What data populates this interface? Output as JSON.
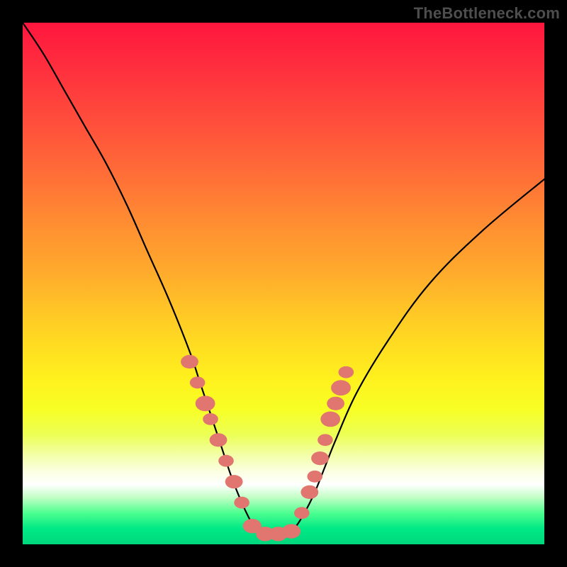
{
  "watermark": "TheBottleneck.com",
  "colors": {
    "gradient_top": "#ff163e",
    "gradient_mid": "#ffd024",
    "gradient_bottom": "#00d77e",
    "curve": "#000000",
    "marker": "#e0766f",
    "frame": "#000000"
  },
  "chart_data": {
    "type": "line",
    "title": "",
    "xlabel": "",
    "ylabel": "",
    "xlim": [
      0,
      100
    ],
    "ylim": [
      0,
      100
    ],
    "grid": false,
    "legend": false,
    "note": "Axes are unlabeled in the source image; x treated as horizontal position 0–100 left→right, y as 0 at bottom to 100 at top. The curve is a V-shaped bottleneck profile: steep descent from upper-left to a flat minimum near x≈44–51 at y≈2, then ascent toward upper-right.",
    "series": [
      {
        "name": "bottleneck-curve",
        "x": [
          0,
          4,
          8,
          12,
          16,
          20,
          24,
          28,
          32,
          34,
          36,
          38,
          40,
          42,
          44,
          46,
          48,
          50,
          52,
          54,
          56,
          58,
          60,
          64,
          70,
          78,
          88,
          100
        ],
        "y": [
          100,
          94,
          87,
          80,
          73,
          65,
          56,
          47,
          37,
          31,
          25,
          19,
          13,
          8,
          4,
          2,
          2,
          2,
          3,
          6,
          10,
          15,
          20,
          29,
          39,
          50,
          60,
          70
        ]
      }
    ],
    "markers": {
      "name": "highlight-dots",
      "note": "Salmon elliptical markers clustered on both flanks of the valley and along the flat bottom.",
      "points": [
        {
          "x": 32.0,
          "y": 35.0,
          "r": 1.6
        },
        {
          "x": 33.5,
          "y": 31.0,
          "r": 1.4
        },
        {
          "x": 35.0,
          "y": 27.0,
          "r": 1.8
        },
        {
          "x": 36.0,
          "y": 24.0,
          "r": 1.4
        },
        {
          "x": 37.5,
          "y": 20.0,
          "r": 1.6
        },
        {
          "x": 39.0,
          "y": 16.0,
          "r": 1.4
        },
        {
          "x": 40.5,
          "y": 12.0,
          "r": 1.6
        },
        {
          "x": 42.0,
          "y": 8.0,
          "r": 1.4
        },
        {
          "x": 44.0,
          "y": 3.5,
          "r": 1.7
        },
        {
          "x": 46.5,
          "y": 2.0,
          "r": 1.7
        },
        {
          "x": 49.0,
          "y": 2.0,
          "r": 1.7
        },
        {
          "x": 51.5,
          "y": 2.5,
          "r": 1.7
        },
        {
          "x": 53.5,
          "y": 6.0,
          "r": 1.4
        },
        {
          "x": 55.0,
          "y": 10.0,
          "r": 1.6
        },
        {
          "x": 56.0,
          "y": 13.0,
          "r": 1.4
        },
        {
          "x": 57.0,
          "y": 16.5,
          "r": 1.6
        },
        {
          "x": 58.0,
          "y": 20.0,
          "r": 1.4
        },
        {
          "x": 59.0,
          "y": 24.0,
          "r": 1.8
        },
        {
          "x": 60.0,
          "y": 27.0,
          "r": 1.6
        },
        {
          "x": 61.0,
          "y": 30.0,
          "r": 1.8
        },
        {
          "x": 62.0,
          "y": 33.0,
          "r": 1.4
        }
      ]
    }
  }
}
